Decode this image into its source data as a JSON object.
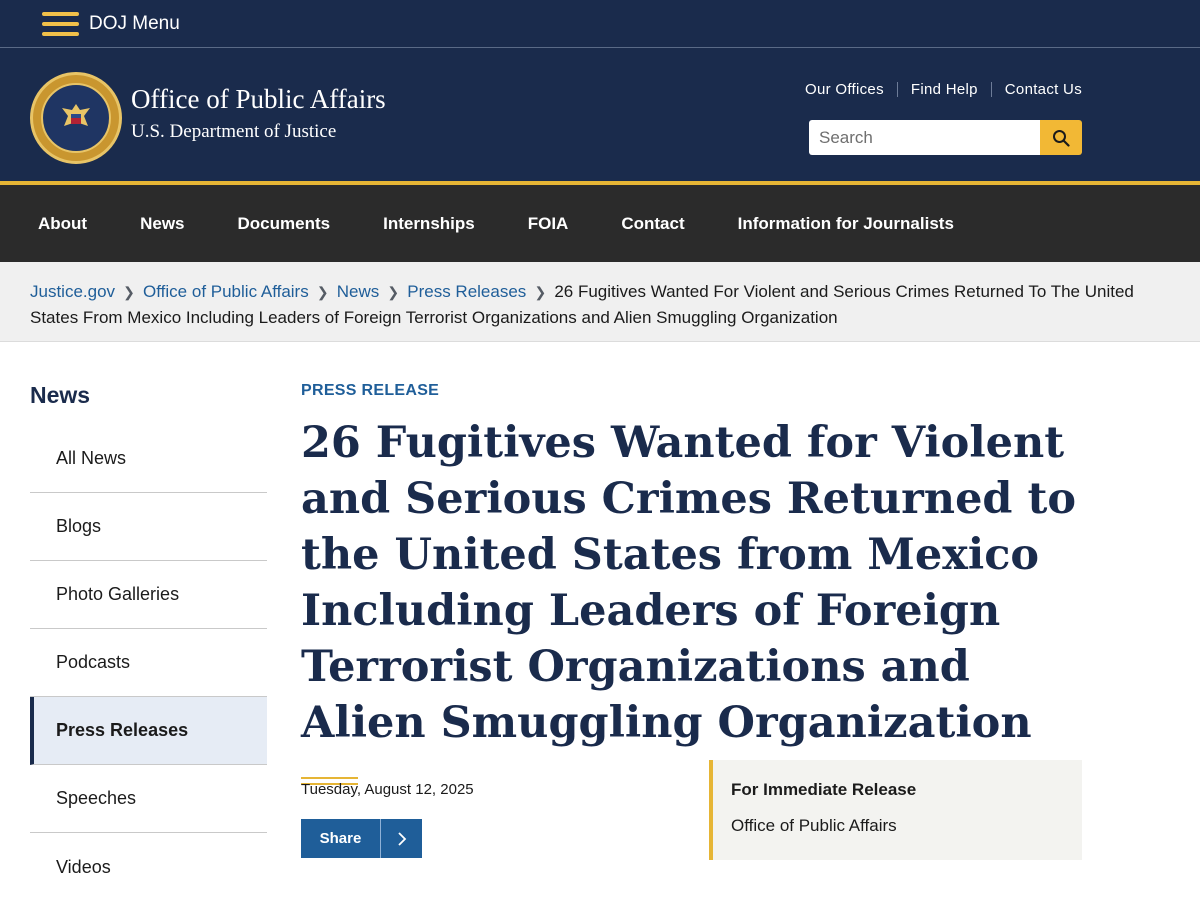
{
  "topbar": {
    "menu_label": "DOJ Menu"
  },
  "header": {
    "title": "Office of Public Affairs",
    "subtitle": "U.S. Department of Justice",
    "util_links": [
      "Our Offices",
      "Find Help",
      "Contact Us"
    ],
    "search_placeholder": "Search"
  },
  "nav": [
    "About",
    "News",
    "Documents",
    "Internships",
    "FOIA",
    "Contact",
    "Information for Journalists"
  ],
  "breadcrumb": {
    "links": [
      "Justice.gov",
      "Office of Public Affairs",
      "News",
      "Press Releases"
    ],
    "current": "26 Fugitives Wanted For Violent and Serious Crimes Returned To The United States From Mexico Including Leaders of Foreign Terrorist Organizations and Alien Smuggling Organization"
  },
  "sidebar": {
    "title": "News",
    "items": [
      "All News",
      "Blogs",
      "Photo Galleries",
      "Podcasts",
      "Press Releases",
      "Speeches",
      "Videos"
    ],
    "active": "Press Releases"
  },
  "article": {
    "kicker": "PRESS RELEASE",
    "headline": "26 Fugitives Wanted for Violent and Serious Crimes Returned to the United States from Mexico Including Leaders of Foreign Terrorist Organizations and Alien Smuggling Organization",
    "date": "Tuesday, August 12, 2025",
    "share_label": "Share",
    "release_title": "For Immediate Release",
    "release_office": "Office of Public Affairs"
  },
  "colors": {
    "navy": "#1a2b4c",
    "gold": "#e6b535",
    "link_blue": "#1f5e99",
    "nav_dark": "#2b2b2b"
  }
}
